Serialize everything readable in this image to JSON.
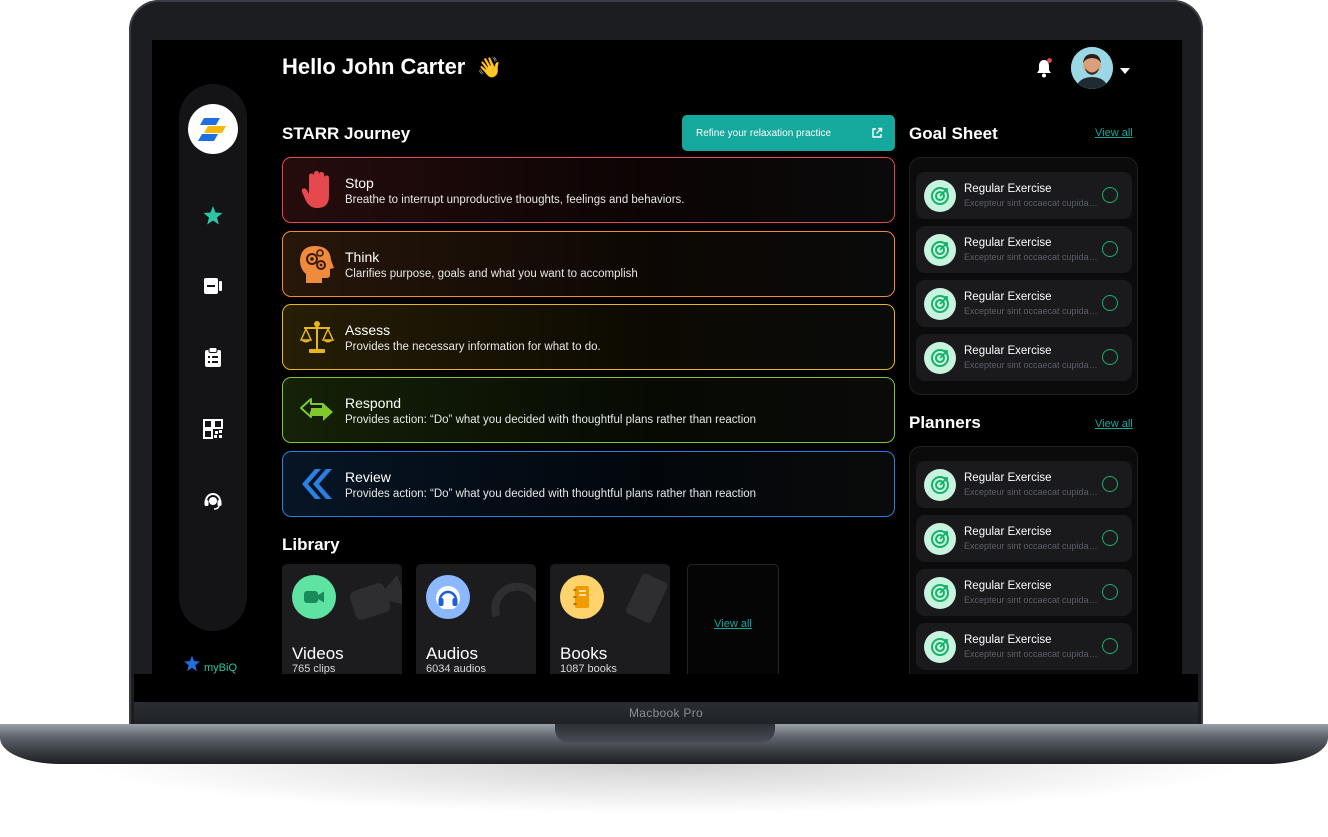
{
  "device": {
    "label": "Macbook Pro"
  },
  "header": {
    "greeting": "Hello John Carter",
    "wave_emoji": "👋"
  },
  "brand": {
    "name": "myBiQ"
  },
  "starr": {
    "title": "STARR Journey",
    "cta_label": "Refine your relaxation practice",
    "items": [
      {
        "title": "Stop",
        "desc": "Breathe to interrupt unproductive thoughts, feelings and behaviors.",
        "color": "#e5484d",
        "icon": "hand-stop-icon"
      },
      {
        "title": "Think",
        "desc": "Clarifies purpose, goals and what you want to accomplish",
        "color": "#f08a3c",
        "icon": "head-gears-icon"
      },
      {
        "title": "Assess",
        "desc": "Provides the necessary information for what to do.",
        "color": "#e7b51e",
        "icon": "scales-icon"
      },
      {
        "title": "Respond",
        "desc": "Provides action: “Do” what you decided with thoughtful plans rather than reaction",
        "color": "#7fc92e",
        "icon": "arrows-exchange-icon"
      },
      {
        "title": "Review",
        "desc": "Provides action: “Do” what you decided with thoughtful plans rather than reaction",
        "color": "#2a7fe0",
        "icon": "double-chevron-left-icon"
      }
    ]
  },
  "library": {
    "title": "Library",
    "view_all": "View all",
    "items": [
      {
        "title": "Videos",
        "count": "765 clips",
        "icon": "video-camera-icon",
        "color": "#5ee3a2"
      },
      {
        "title": "Audios",
        "count": "6034 audios",
        "icon": "headphones-icon",
        "color": "#8bb8ff"
      },
      {
        "title": "Books",
        "count": "1087 books",
        "icon": "notebook-icon",
        "color": "#ffc94d"
      }
    ]
  },
  "goals": {
    "title": "Goal Sheet",
    "view_all": "View all",
    "items": [
      {
        "title": "Regular Exercise",
        "desc": "Excepteur sint occaecat cupidatat non proident"
      },
      {
        "title": "Regular Exercise",
        "desc": "Excepteur sint occaecat cupidatat non proident"
      },
      {
        "title": "Regular Exercise",
        "desc": "Excepteur sint occaecat cupidatat non proident"
      },
      {
        "title": "Regular Exercise",
        "desc": "Excepteur sint occaecat cupidatat non proident"
      }
    ]
  },
  "planners": {
    "title": "Planners",
    "view_all": "View all",
    "items": [
      {
        "title": "Regular Exercise",
        "desc": "Excepteur sint occaecat cupidatat non proident"
      },
      {
        "title": "Regular Exercise",
        "desc": "Excepteur sint occaecat cupidatat non proident"
      },
      {
        "title": "Regular Exercise",
        "desc": "Excepteur sint occaecat cupidatat non proident"
      },
      {
        "title": "Regular Exercise",
        "desc": "Excepteur sint occaecat cupidatat non proident"
      }
    ]
  },
  "nav": {
    "items": [
      {
        "icon": "star-person-icon",
        "color": "#2dc5a6"
      },
      {
        "icon": "journal-icon",
        "color": "#ffffff"
      },
      {
        "icon": "clipboard-icon",
        "color": "#ffffff"
      },
      {
        "icon": "qr-code-icon",
        "color": "#ffffff"
      },
      {
        "icon": "headset-support-icon",
        "color": "#ffffff"
      }
    ]
  },
  "theme": {
    "accent": "#14a99c",
    "success": "#16b16a"
  }
}
